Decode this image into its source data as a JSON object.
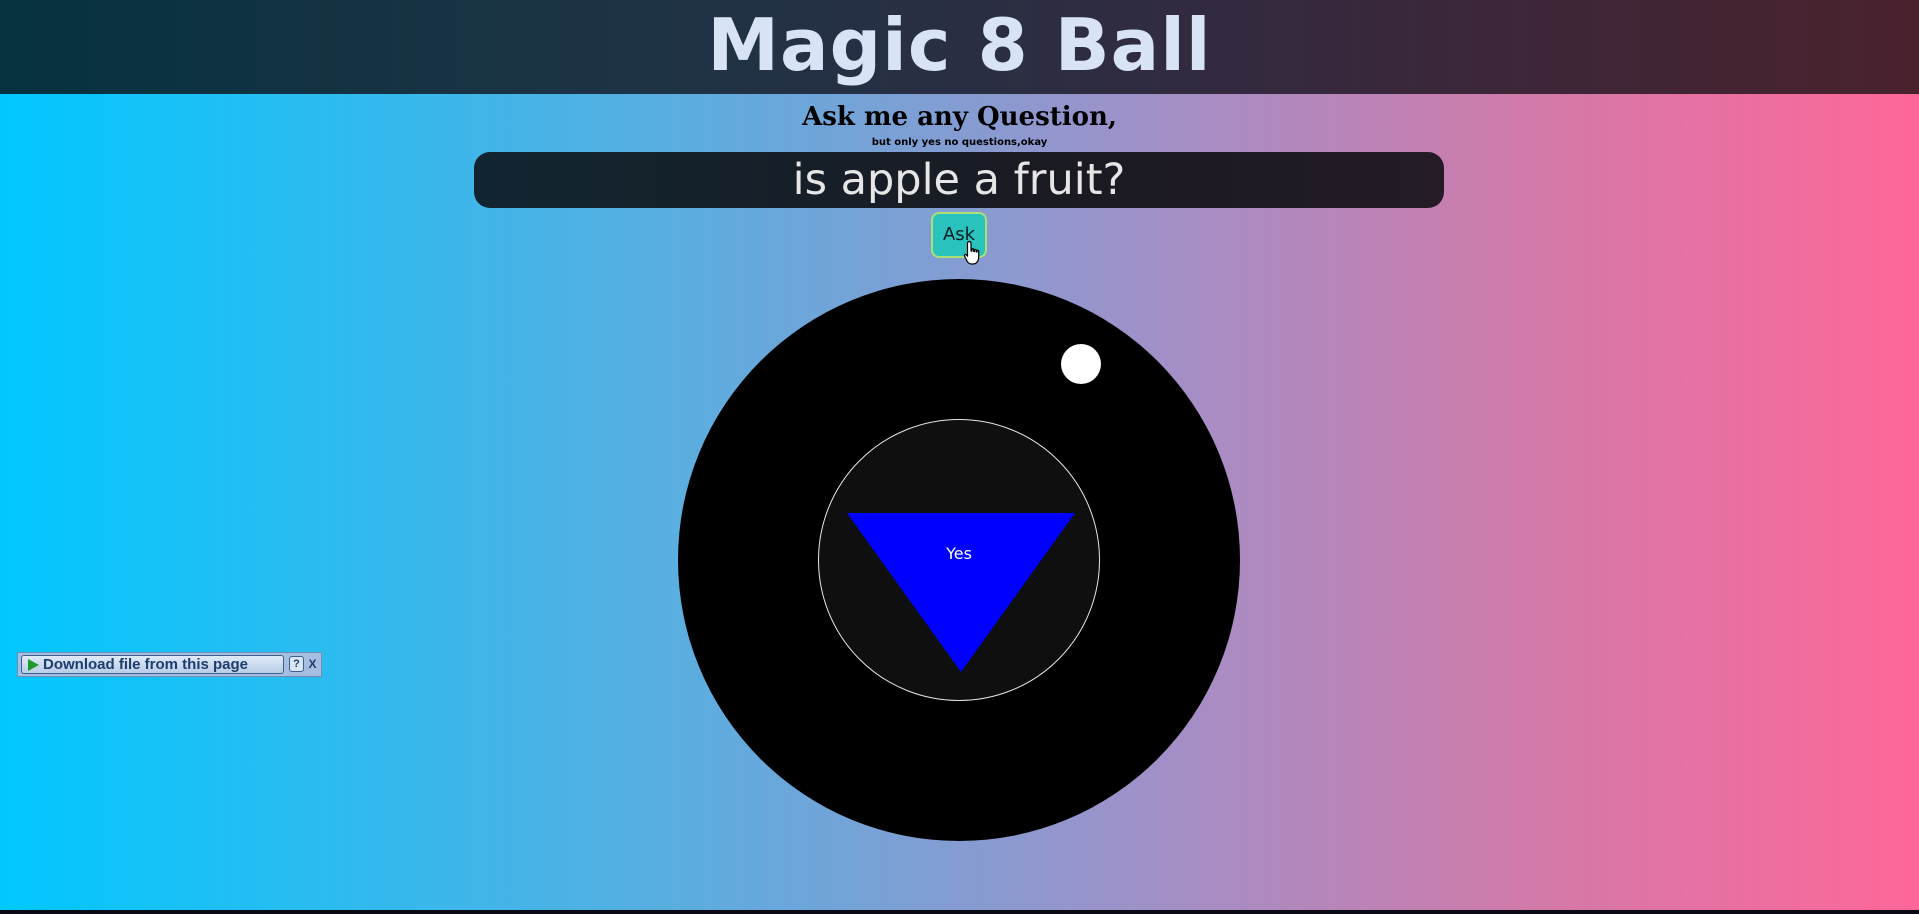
{
  "app": {
    "title": "Magic 8 Ball"
  },
  "prompt": {
    "heading": "Ask me any Question,",
    "subheading": "but only yes no questions,okay"
  },
  "question_input": {
    "value": "is apple a fruit?"
  },
  "ask_button": {
    "label": "Ask"
  },
  "ball": {
    "answer": "Yes",
    "triangle_color": "#0000ff"
  },
  "download_toolbar": {
    "label": "Download file from this page",
    "help_label": "?",
    "close_label": "X"
  },
  "colors": {
    "accent_button": "#2ac2bd",
    "gradient_left": "#00c8ff",
    "gradient_right": "#ff6699"
  }
}
